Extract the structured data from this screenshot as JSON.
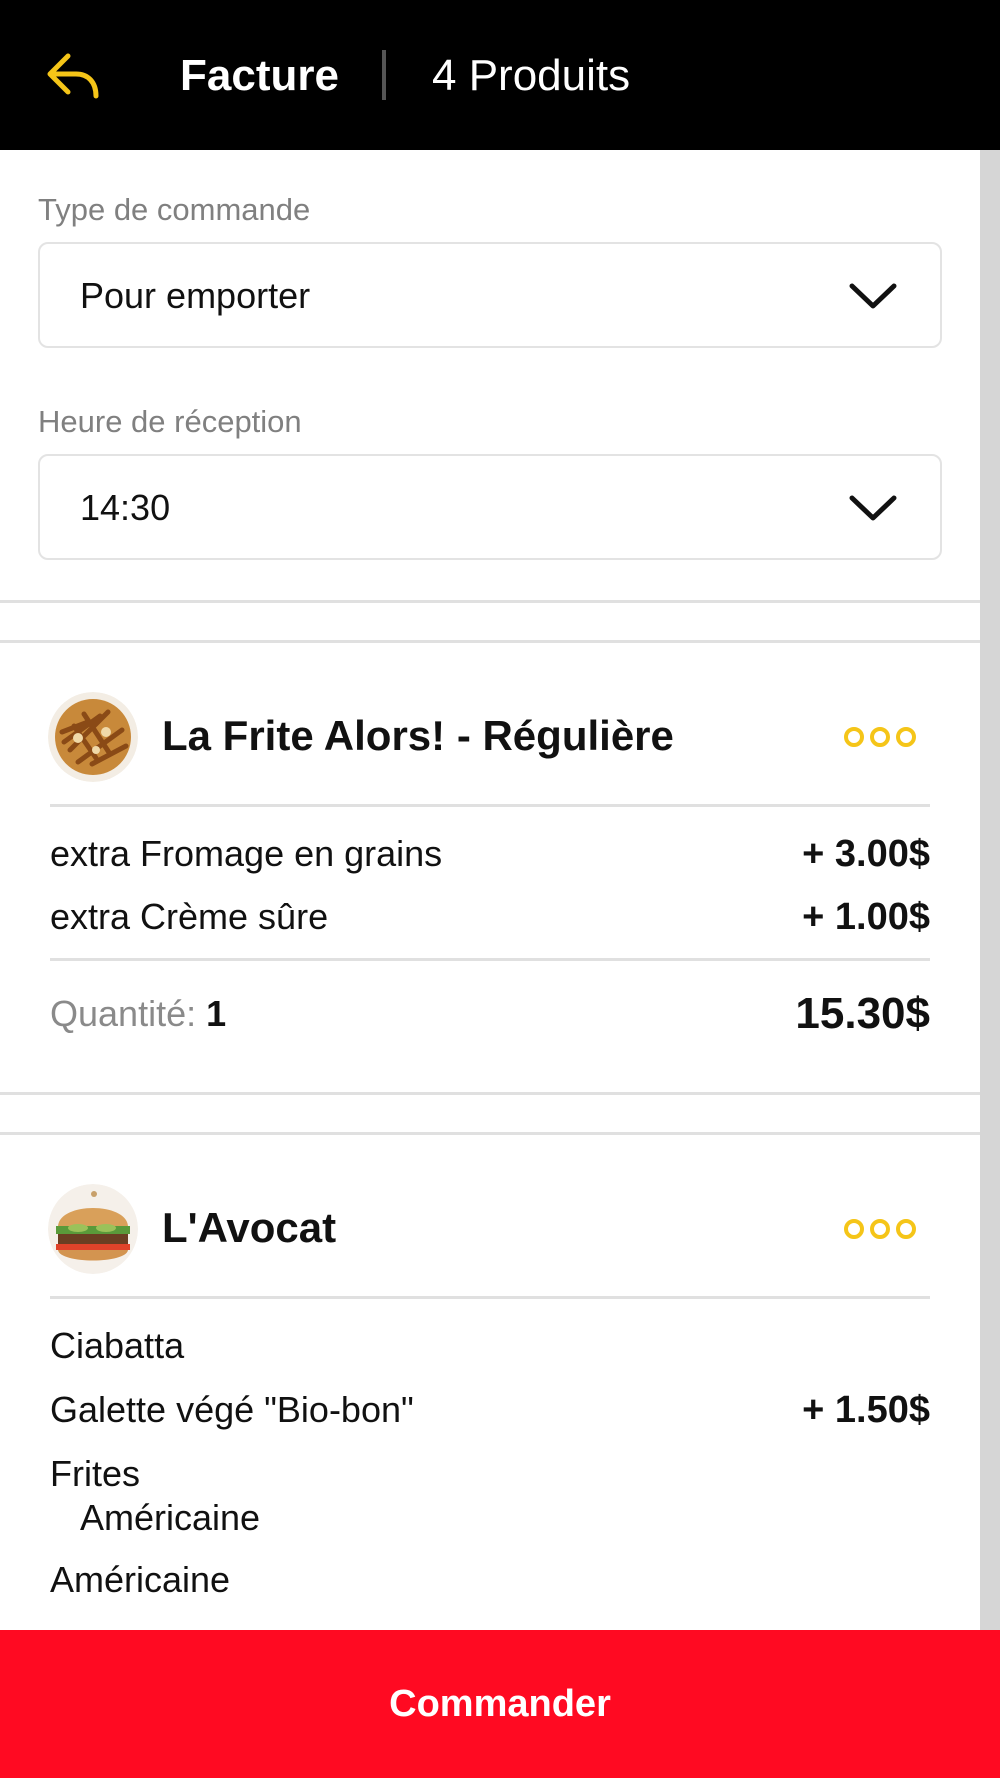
{
  "header": {
    "title": "Facture",
    "product_count": "4 Produits",
    "back_icon": "reply-arrow-icon"
  },
  "form": {
    "order_type": {
      "label": "Type de commande",
      "value": "Pour emporter"
    },
    "pickup_time": {
      "label": "Heure de réception",
      "value": "14:30"
    }
  },
  "products": [
    {
      "name": "La Frite Alors! - Régulière",
      "options": [
        {
          "label": "extra Fromage en grains",
          "price": "+ 3.00$"
        },
        {
          "label": "extra Crème sûre",
          "price": "+ 1.00$"
        }
      ],
      "quantity_label": "Quantité:",
      "quantity": "1",
      "total": "15.30$"
    },
    {
      "name": "L'Avocat",
      "options": [
        {
          "label": "Ciabatta",
          "price": ""
        },
        {
          "label": "Galette végé \"Bio-bon\"",
          "price": "+ 1.50$"
        },
        {
          "label": "Frites",
          "price": ""
        },
        {
          "label": "Américaine",
          "price": ""
        },
        {
          "label": "Américaine",
          "price": ""
        }
      ]
    }
  ],
  "order_button": {
    "label": "Commander"
  },
  "colors": {
    "accent_yellow": "#f5c518",
    "order_red": "#ff0a22",
    "header_bg": "#000000"
  }
}
